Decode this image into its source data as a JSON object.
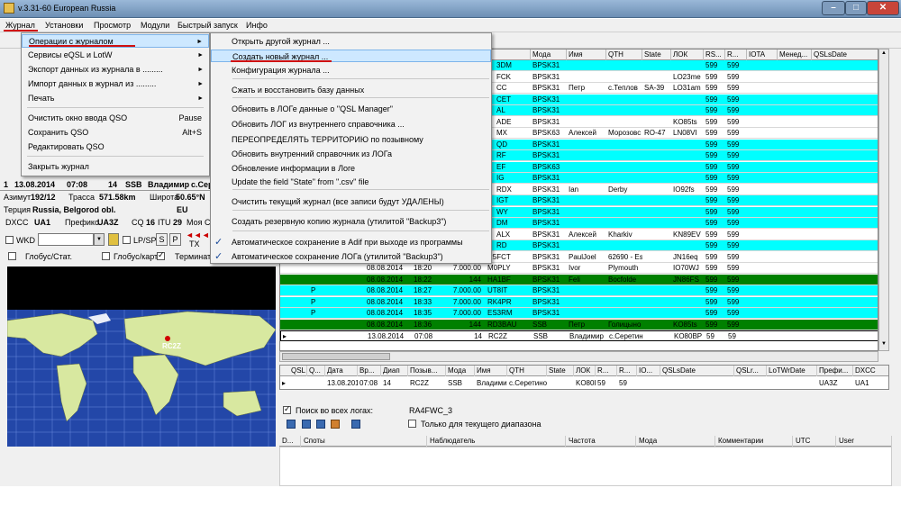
{
  "window": {
    "title": "v.3.31-60 European Russia"
  },
  "menubar": {
    "items": [
      "Журнал",
      "Установки",
      "Просмотр",
      "Модули",
      "Быстрый запуск",
      "Инфо"
    ]
  },
  "journal_menu": {
    "items": [
      {
        "label": "Операции с журналом",
        "shortcut": "",
        "submenu": true
      },
      {
        "label": "Сервисы eQSL и LotW",
        "shortcut": "",
        "submenu": true
      },
      {
        "label": "Экспорт данных из журнала в .........",
        "shortcut": "",
        "submenu": true
      },
      {
        "label": "Импорт данных в журнал из .........",
        "shortcut": "",
        "submenu": true
      },
      {
        "label": "Печать",
        "shortcut": "",
        "submenu": true
      },
      {
        "label": "Очистить окно ввода QSO",
        "shortcut": "Pause",
        "submenu": false
      },
      {
        "label": "Сохранить QSO",
        "shortcut": "Alt+S",
        "submenu": false
      },
      {
        "label": "Редактировать QSO",
        "shortcut": "",
        "submenu": false
      },
      {
        "label": "Закрыть журнал",
        "shortcut": "",
        "submenu": false
      }
    ]
  },
  "operations_submenu": {
    "items": [
      {
        "label": "Открыть другой журнал ...",
        "checked": false
      },
      {
        "label": "Создать новый журнал ...",
        "checked": false
      },
      {
        "label": "Конфигурация журнала ...",
        "checked": false
      },
      {
        "label": "Сжать и восстановить базу данных",
        "checked": false
      },
      {
        "label": "Обновить в ЛОГе данные о \"QSL Manager\"",
        "checked": false
      },
      {
        "label": "Обновить ЛОГ из внутреннего справочника ...",
        "checked": false
      },
      {
        "label": "ПЕРЕОПРЕДЕЛЯТЬ ТЕРРИТОРИЮ по позывному",
        "checked": false
      },
      {
        "label": "Обновить внутренний справочник из ЛОГа",
        "checked": false
      },
      {
        "label": "Обновление информации в Логе",
        "checked": false
      },
      {
        "label": "Update the field \"State\" from \".csv\" file",
        "checked": false
      },
      {
        "label": "Очистить текущий журнал (все записи будут УДАЛЕНЫ)",
        "checked": false
      },
      {
        "label": "Создать резервную копию журнала (утилитой \"Backup3\")",
        "checked": false
      },
      {
        "label": "Автоматическое сохранение в Adif при выходе из программы",
        "checked": true
      },
      {
        "label": "Автоматическое сохранение ЛОГа (утилитой \"Backup3\")",
        "checked": true
      }
    ]
  },
  "log_grid": {
    "columns": [
      "",
      "",
      "",
      "",
      "",
      "",
      "Мода",
      "Имя",
      "QTH",
      "State",
      "ЛОК",
      "RS...",
      "R...",
      "IOTA",
      "Менед...",
      "QSLsDate"
    ],
    "rows": [
      {
        "call": "3DM",
        "mode": "BPSK31",
        "name": "",
        "qth": "",
        "state": "",
        "loc": "",
        "rs": "599",
        "r": "599",
        "color": "cyan"
      },
      {
        "call": "FCK",
        "mode": "BPSK31",
        "name": "",
        "qth": "",
        "state": "",
        "loc": "LO23me",
        "rs": "599",
        "r": "599",
        "color": "white"
      },
      {
        "call": "CC",
        "mode": "BPSK31",
        "name": "Петр",
        "qth": "с.Теплов",
        "state": "SA-39",
        "loc": "LO31am",
        "rs": "599",
        "r": "599",
        "color": "white"
      },
      {
        "call": "CET",
        "mode": "BPSK31",
        "name": "",
        "qth": "",
        "state": "",
        "loc": "",
        "rs": "599",
        "r": "599",
        "color": "cyan"
      },
      {
        "call": "AL",
        "mode": "BPSK31",
        "name": "",
        "qth": "",
        "state": "",
        "loc": "",
        "rs": "599",
        "r": "599",
        "color": "cyan"
      },
      {
        "call": "ADE",
        "mode": "BPSK31",
        "name": "",
        "qth": "",
        "state": "",
        "loc": "KO85ts",
        "rs": "599",
        "r": "599",
        "color": "white"
      },
      {
        "call": "MX",
        "mode": "BPSK63",
        "name": "Алексей",
        "qth": "Морозовс",
        "state": "RO-47",
        "loc": "LN08VI",
        "rs": "599",
        "r": "599",
        "color": "white"
      },
      {
        "call": "QD",
        "mode": "BPSK31",
        "name": "",
        "qth": "",
        "state": "",
        "loc": "",
        "rs": "599",
        "r": "599",
        "color": "cyan"
      },
      {
        "call": "RF",
        "mode": "BPSK31",
        "name": "",
        "qth": "",
        "state": "",
        "loc": "",
        "rs": "599",
        "r": "599",
        "color": "cyan"
      },
      {
        "call": "EF",
        "mode": "BPSK63",
        "name": "",
        "qth": "",
        "state": "",
        "loc": "",
        "rs": "599",
        "r": "599",
        "color": "cyan"
      },
      {
        "call": "IG",
        "mode": "BPSK31",
        "name": "",
        "qth": "",
        "state": "",
        "loc": "",
        "rs": "599",
        "r": "599",
        "color": "cyan"
      },
      {
        "call": "RDX",
        "mode": "BPSK31",
        "name": "Ian",
        "qth": "Derby",
        "state": "",
        "loc": "IO92fs",
        "rs": "599",
        "r": "599",
        "color": "white"
      },
      {
        "call": "IGT",
        "mode": "BPSK31",
        "name": "",
        "qth": "",
        "state": "",
        "loc": "",
        "rs": "599",
        "r": "599",
        "color": "cyan"
      },
      {
        "call": "WY",
        "mode": "BPSK31",
        "name": "",
        "qth": "",
        "state": "",
        "loc": "",
        "rs": "599",
        "r": "599",
        "color": "cyan"
      },
      {
        "call": "DM",
        "mode": "BPSK31",
        "name": "",
        "qth": "",
        "state": "",
        "loc": "",
        "rs": "599",
        "r": "599",
        "color": "cyan"
      },
      {
        "call": "ALX",
        "mode": "BPSK31",
        "name": "Алексей",
        "qth": "Kharkiv",
        "state": "",
        "loc": "KN89EV",
        "rs": "599",
        "r": "599",
        "color": "white"
      },
      {
        "call": "RD",
        "mode": "BPSK31",
        "name": "",
        "qth": "",
        "state": "",
        "loc": "",
        "rs": "599",
        "r": "599",
        "color": "cyan"
      }
    ],
    "rows_full": [
      {
        "p": "",
        "date": "08.08.2014",
        "time": "18:17",
        "freq": "7.000.00",
        "call": "R5FCT",
        "mode": "BPSK31",
        "name": "PaulJoel",
        "qth": "62690 - Es",
        "state": "",
        "loc": "JN16eq",
        "rs": "599",
        "r": "599",
        "color": "white"
      },
      {
        "p": "",
        "date": "08.08.2014",
        "time": "18:20",
        "freq": "7.000.00",
        "call": "M0PLY",
        "mode": "BPSK31",
        "name": "Ivor",
        "qth": "Plymouth",
        "state": "",
        "loc": "IO70WJ",
        "rs": "599",
        "r": "599",
        "color": "white"
      },
      {
        "p": "",
        "date": "08.08.2014",
        "time": "18:22",
        "freq": "144",
        "call": "HA1BF",
        "mode": "BPSK31",
        "name": "Feli",
        "qth": "Bocfolde",
        "state": "",
        "loc": "JN86FS",
        "rs": "599",
        "r": "599",
        "color": "green"
      },
      {
        "p": "P",
        "date": "08.08.2014",
        "time": "18:27",
        "freq": "7.000.00",
        "call": "UT8IT",
        "mode": "BPSK31",
        "name": "",
        "qth": "",
        "state": "",
        "loc": "",
        "rs": "599",
        "r": "599",
        "color": "cyan"
      },
      {
        "p": "P",
        "date": "08.08.2014",
        "time": "18:33",
        "freq": "7.000.00",
        "call": "RK4PR",
        "mode": "BPSK31",
        "name": "",
        "qth": "",
        "state": "",
        "loc": "",
        "rs": "599",
        "r": "599",
        "color": "cyan"
      },
      {
        "p": "P",
        "date": "08.08.2014",
        "time": "18:35",
        "freq": "7.000.00",
        "call": "ES3RM",
        "mode": "BPSK31",
        "name": "",
        "qth": "",
        "state": "",
        "loc": "",
        "rs": "599",
        "r": "599",
        "color": "cyan"
      },
      {
        "p": "",
        "date": "08.08.2014",
        "time": "18:36",
        "freq": "144",
        "call": "RD3BAU",
        "mode": "SSB",
        "name": "Петр",
        "qth": "Голицыно",
        "state": "",
        "loc": "KO85ts",
        "rs": "599",
        "r": "599",
        "color": "green"
      },
      {
        "p": "",
        "date": "13.08.2014",
        "time": "07:08",
        "freq": "14",
        "call": "RC2Z",
        "mode": "SSB",
        "name": "Владимир",
        "qth": "с.Серетин",
        "state": "",
        "loc": "KO80BP",
        "rs": "59",
        "r": "59",
        "color": "white"
      }
    ]
  },
  "qso_grid": {
    "columns": [
      "QSL",
      "Q...",
      "Дата",
      "Вр...",
      "Диап",
      "Позыв...",
      "Мода",
      "Имя",
      "QTH",
      "State",
      "ЛОК",
      "R...",
      "R...",
      "IO...",
      "QSLsDate",
      "QSLr...",
      "LoTWrDate",
      "Префи...",
      "DXCC"
    ],
    "row": [
      "",
      "",
      "13.08.201",
      "07:08",
      "14",
      "RC2Z",
      "SSB",
      "Владими",
      "с.Серетино",
      "",
      "KO80I",
      "59",
      "59",
      "",
      "",
      "",
      "",
      "UA3Z",
      "UA1"
    ]
  },
  "entry_panel": {
    "num": "1",
    "date": "13.08.2014",
    "time": "07:08",
    "band": "14",
    "mode": "SSB",
    "name": "Владимир",
    "qth": "с.Сер",
    "azimuth_label": "Азимут",
    "azimuth": "192/12",
    "path_label": "Трасса",
    "path": "571.58km",
    "lat_label": "Широта",
    "lat": "50.65°N",
    "territory_label": "Терция",
    "territory": "Russia, Belgorod obl.",
    "cont": "EU",
    "dxcc_label": "DXCC",
    "dxcc": "UA1",
    "prefix_label": "Префикс",
    "prefix": "UA3Z",
    "cq_label": "CQ",
    "cq": "16",
    "itu_label": "ITU",
    "itu": "29",
    "my_label": "Моя С",
    "wkd": "WKD",
    "lpsp": "LP/SP",
    "s": "S",
    "p": "P",
    "tx": "TX",
    "globe_stat": "Глобус/Стат.",
    "globe_map": "Глобус/карт.",
    "terminal": "Терминат"
  },
  "map": {
    "callsign": "RC2Z"
  },
  "search": {
    "all_logs_label": "Поиск во всех логах:",
    "callsign": "RA4FWC_3",
    "current_band_label": "Только для текущего диапазона"
  },
  "cluster": {
    "columns": [
      "D...",
      "Споты",
      "Наблюдатель",
      "Частота",
      "Мода",
      "Комментарии",
      "UTC",
      "User"
    ]
  },
  "colors": {
    "cyan": "#00ffff",
    "green": "#008000",
    "highlight": "#cde8ff",
    "underline": "#d01010"
  }
}
